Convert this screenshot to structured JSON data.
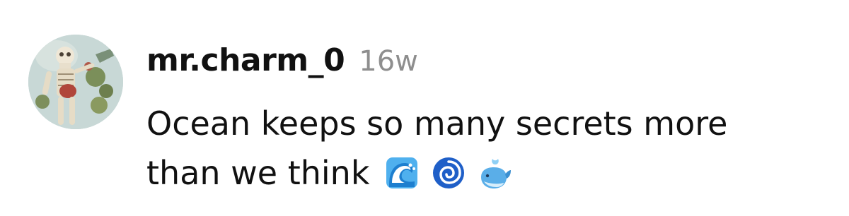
{
  "comment": {
    "username": "mr.charm_0",
    "timestamp": "16w",
    "text_line1": "Ocean keeps so many secrets more",
    "text_line2": "than we think",
    "emojis": [
      "water-wave-emoji",
      "cyclone-emoji",
      "spouting-whale-emoji"
    ]
  },
  "colors": {
    "text": "#111111",
    "timestamp": "#8e8e8e",
    "wave": "#3aa0e6",
    "cyclone": "#1f5fc8",
    "whale": "#5aaee8"
  }
}
